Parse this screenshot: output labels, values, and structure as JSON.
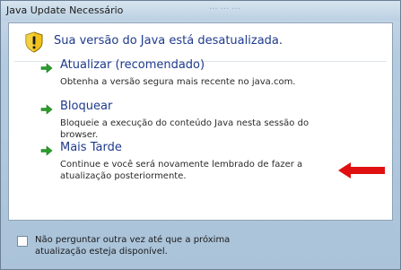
{
  "window": {
    "title": "Java Update Necessário",
    "ghost_title": "··· ··· ···"
  },
  "header": {
    "icon": "warning-shield-icon",
    "text": "Sua versão do Java está desatualizada."
  },
  "options": [
    {
      "icon": "green-arrow-icon",
      "title": "Atualizar (recomendado)",
      "description": "Obtenha a versão segura mais recente no java.com."
    },
    {
      "icon": "green-arrow-icon",
      "title": "Bloquear",
      "description": "Bloqueie a execução do conteúdo Java nesta sessão do browser."
    },
    {
      "icon": "green-arrow-icon",
      "title": "Mais Tarde",
      "description": "Continue e você será novamente lembrado de fazer a atualização posteriormente."
    }
  ],
  "annotation": {
    "icon": "red-arrow-icon",
    "color": "#e01010"
  },
  "footer": {
    "checkbox_checked": false,
    "checkbox_label": "Não perguntar outra vez até que a próxima atualização esteja disponível."
  },
  "colors": {
    "heading": "#1e3a8c",
    "arrow_green": "#2a9d2a"
  }
}
